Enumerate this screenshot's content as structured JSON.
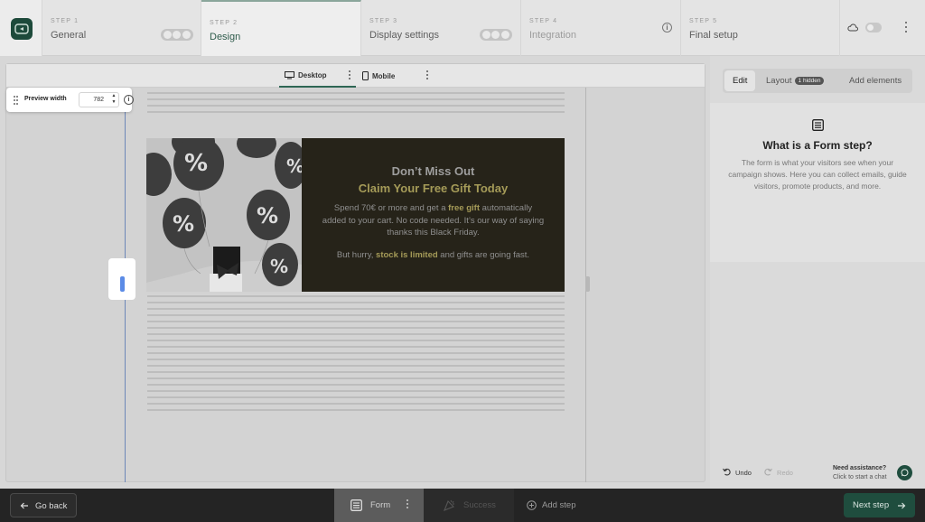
{
  "stepper": {
    "steps": [
      {
        "num": "STEP 1",
        "name": "General"
      },
      {
        "num": "STEP 2",
        "name": "Design"
      },
      {
        "num": "STEP 3",
        "name": "Display settings"
      },
      {
        "num": "STEP 4",
        "name": "Integration"
      },
      {
        "num": "STEP 5",
        "name": "Final setup"
      }
    ]
  },
  "device_bar": {
    "desktop": "Desktop",
    "mobile": "Mobile"
  },
  "preview_width": {
    "label": "Preview width",
    "value": "782"
  },
  "banner": {
    "title": "Don’t Miss Out",
    "subtitle": "Claim Your Free Gift Today",
    "body_pre": "Spend 70€ or more and get a ",
    "body_bold": "free gift",
    "body_post": " automatically added to your cart. No code needed. It’s our way of saying thanks this Black Friday.",
    "body2_pre": "But hurry, ",
    "body2_bold": "stock is limited",
    "body2_post": " and gifts are going fast."
  },
  "right_panel": {
    "tabs": [
      "Edit",
      "Layout",
      "Add elements"
    ],
    "layout_badge": "1 hidden",
    "help_title": "What is a Form step?",
    "help_text": "The form is what your visitors see when your campaign shows. Here you can collect emails, guide visitors, promote products, and more.",
    "undo": "Undo",
    "redo": "Redo",
    "assist_title": "Need assistance?",
    "assist_sub": "Click to start a chat"
  },
  "bottom_bar": {
    "go_back": "Go back",
    "form": "Form",
    "success": "Success",
    "add_step": "Add step",
    "next_step": "Next step"
  },
  "colors": {
    "brand": "#1f4d3e",
    "banner_bg": "#262319",
    "banner_accent": "#a59b58"
  }
}
